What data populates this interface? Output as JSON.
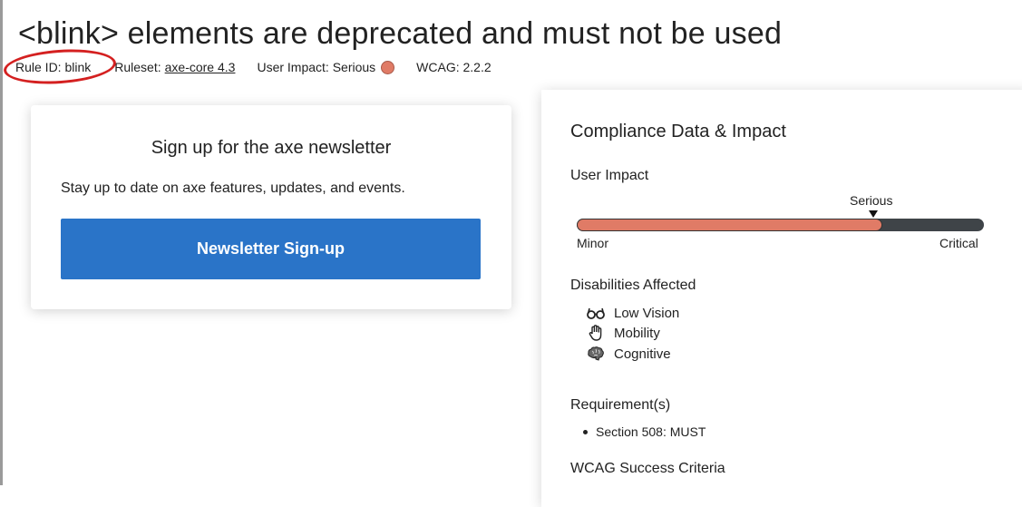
{
  "page": {
    "title": "<blink> elements are deprecated and must not be used"
  },
  "meta": {
    "rule_id": "Rule ID: blink",
    "ruleset_label": "Ruleset:",
    "ruleset_link": "axe-core 4.3",
    "user_impact": "User Impact: Serious",
    "wcag": "WCAG: 2.2.2",
    "impact_color": "#e07b66"
  },
  "newsletter": {
    "title": "Sign up for the axe newsletter",
    "text": "Stay up to date on axe features, updates, and events.",
    "button_label": "Newsletter Sign-up",
    "button_color": "#2a74c8"
  },
  "compliance": {
    "heading": "Compliance Data & Impact",
    "user_impact_label": "User Impact",
    "impact_level_label": "Serious",
    "impact_level_fraction": 0.75,
    "scale_min": "Minor",
    "scale_max": "Critical",
    "disabilities_label": "Disabilities Affected",
    "disabilities": [
      {
        "label": "Low Vision",
        "icon": "glasses-icon"
      },
      {
        "label": "Mobility",
        "icon": "hand-icon"
      },
      {
        "label": "Cognitive",
        "icon": "brain-icon"
      }
    ],
    "requirements_label": "Requirement(s)",
    "requirements": [
      "Section 508: MUST"
    ],
    "wcag_label": "WCAG Success Criteria"
  }
}
